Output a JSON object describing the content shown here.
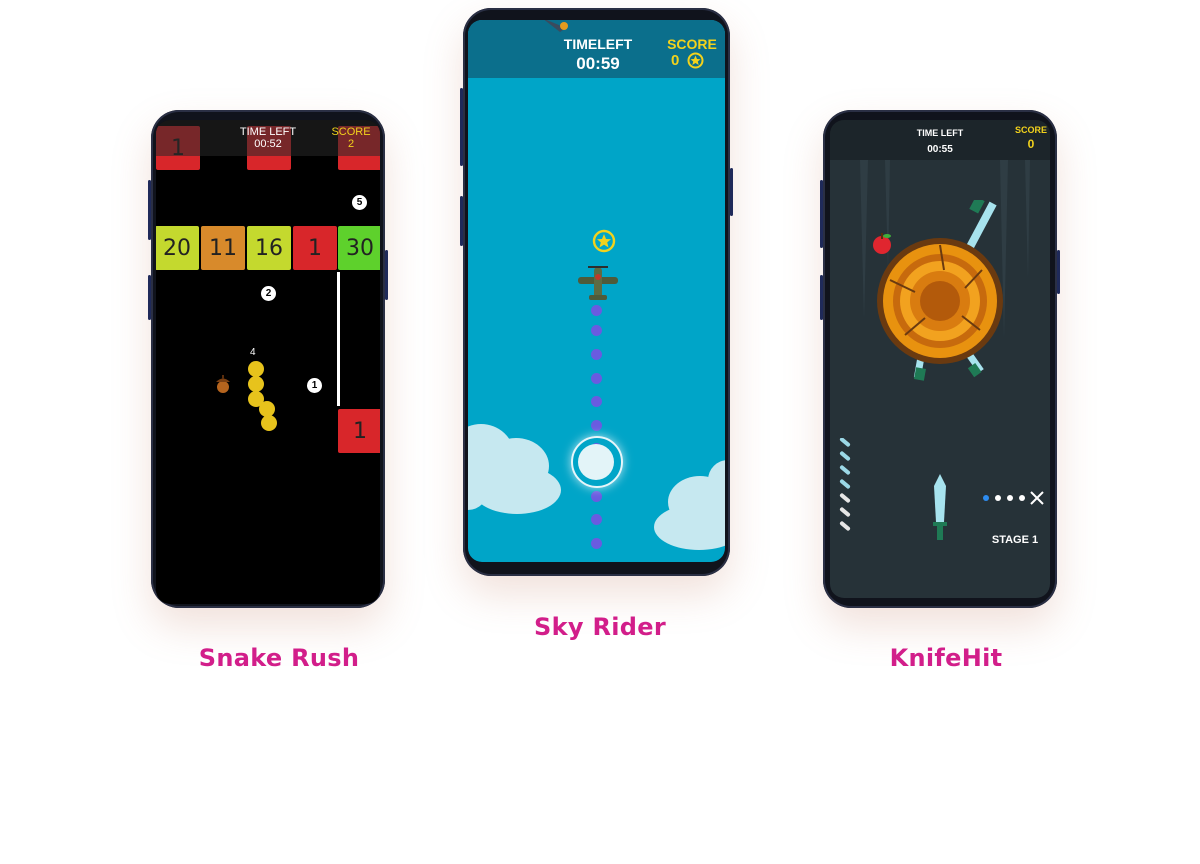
{
  "games": [
    {
      "caption": "Snake Rush",
      "hud": {
        "time_label": "TIME LEFT",
        "time_value": "00:52",
        "score_label": "SCORE",
        "score_value": "2"
      },
      "top_blocks": [
        "1",
        "",
        ""
      ],
      "block_row": [
        {
          "value": "20",
          "color": "#c4d92e"
        },
        {
          "value": "11",
          "color": "#d88a2b"
        },
        {
          "value": "16",
          "color": "#c4d92e"
        },
        {
          "value": "1",
          "color": "#d8262a"
        },
        {
          "value": "30",
          "color": "#5ed12c"
        }
      ],
      "bottom_block": "1",
      "tokens": [
        "5",
        "2",
        "1"
      ],
      "snake_length": "4"
    },
    {
      "caption": "Sky Rider",
      "hud": {
        "time_label": "TIMELEFT",
        "time_value": "00:59",
        "score_label": "SCORE",
        "score_value": "0"
      }
    },
    {
      "caption": "KnifeHit",
      "hud": {
        "time_label": "TIME LEFT",
        "time_value": "00:55",
        "score_label": "SCORE",
        "score_value": "0"
      },
      "stage": "STAGE 1"
    }
  ],
  "colors": {
    "caption": "#d21e8a",
    "score": "#f2d21c"
  }
}
